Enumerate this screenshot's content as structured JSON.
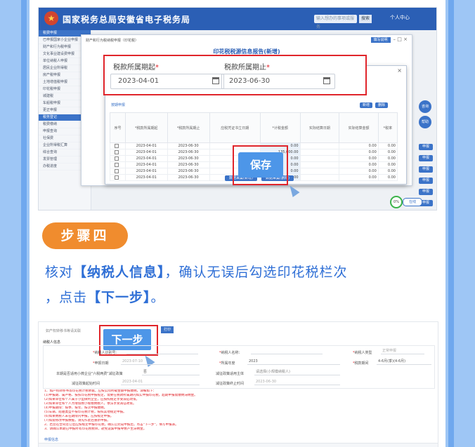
{
  "screenshot_top": {
    "app_title": "国家税务总局安徽省电子税务局",
    "search_placeholder": "输入想办的事项或服务",
    "search_button": "搜索",
    "user": "个人中心",
    "sidebar_items": [
      "税费申报",
      "已申报国家小企业申报",
      "财产和行为税申报",
      "文化事业建设费申报",
      "单位纳税人申报",
      "居民企业所得税",
      "房产税申报",
      "土地增值税申报",
      "印花税申报",
      "城建税",
      "车船税申报",
      "更正申报",
      "税务登记",
      "税费缴纳",
      "申报查询",
      "社保费",
      "企业所得税汇算",
      "综合查询",
      "发票管理",
      "办税进度"
    ],
    "outer_dialog_title": "财产和行为税纳税申报（印花税）",
    "outer_tag": "填写说明",
    "outer_form_title": "印花税税源信息报告(新增)",
    "period_start_label": "税款所属期起",
    "period_start_value": "2023-04-01",
    "period_end_label": "税款所属期止",
    "period_end_value": "2023-06-30",
    "required_mark": "*",
    "inner_section_label": "按期申报",
    "inner_pill_1": "新增",
    "inner_pill_2": "删除",
    "grid_headers": [
      "序号",
      "*税款所属期起",
      "*税款所属期止",
      "应税凭证书立日期",
      "*计税金额",
      "实际结算日期",
      "实际结算金额",
      "*税率"
    ],
    "grid_rows": [
      {
        "start": "2023-04-01",
        "end": "2023-06-30",
        "amount": "0.00",
        "settle": "0.00",
        "rate": "0.00"
      },
      {
        "start": "2023-04-01",
        "end": "2023-06-30",
        "amount": "135,000.00",
        "settle": "0.00",
        "rate": "0.00"
      },
      {
        "start": "2023-04-01",
        "end": "2023-06-30",
        "amount": "0.00",
        "settle": "0.00",
        "rate": "0.00"
      },
      {
        "start": "2023-04-01",
        "end": "2023-06-30",
        "amount": "0.00",
        "settle": "0.00",
        "rate": "0.00"
      },
      {
        "start": "2023-04-01",
        "end": "2023-06-30",
        "amount": "0.00",
        "settle": "0.00",
        "rate": "0.00"
      },
      {
        "start": "2023-04-01",
        "end": "2023-06-30",
        "amount": "0.00",
        "settle": "0.00",
        "rate": "0.00"
      }
    ],
    "bottom_btn_1": "数据采集(新增)",
    "bottom_btn_2": "数据采集(删除)",
    "save_label": "保存",
    "right_buttons": [
      "申报",
      "申报",
      "申报",
      "申报",
      "申报",
      "申报"
    ],
    "circle_buttons": [
      "咨询",
      "帮助"
    ],
    "status_circle": "0%",
    "status_pill": "在线"
  },
  "step": {
    "badge": "步骤四",
    "desc_line1_pre": "核对",
    "desc_line1_bold": "【纳税人信息】",
    "desc_line1_post": "，确认无误后勾选印花税栏次",
    "desc_line2_pre": "，点击",
    "desc_line2_bold": "【下一步】",
    "desc_line2_post": "。"
  },
  "screenshot_bottom": {
    "hint": "如产权转移书等请关联",
    "small_button": "打印",
    "next_label": "下一步",
    "section_title": "纳税人信息",
    "fields": {
      "taxpayer_id_label": "纳税人识别号：",
      "taxpayer_name_label": "纳税人名称：",
      "taxpayer_type_label": "纳税人类型",
      "taxpayer_type_value": "正常申报",
      "apply_date_label": "申报日期",
      "apply_date_value": "2023-07-10",
      "year_label": "所属年度",
      "year_value": "2023",
      "period_label": "税款期间",
      "period_value": "4-6月(季)(4-6月)",
      "small_biz_label": "本期是否适用小微企业\"六税两费\"减征政策",
      "small_biz_value": "否",
      "reduce_subject_label": "减征政策适用主体",
      "reduce_subject_value": "请选择(小规模纳税人)",
      "reduce_start_label": "减征政策起始时间",
      "reduce_start_value": "2023-04-01",
      "reduce_end_label": "减征政策终止时间",
      "reduce_end_value": "2023-06-30"
    },
    "notes": [
      "1、如产权转移书等印花税计税依据，应按实际所载金额申报缴纳，详细如下：",
      "(1)申报期、属严格、按照印花税申报规定，需要在税款所属期内如实申报印花税，超期申报需缴纳滞纳金。",
      "(2)如果单位和个人属于小型微利企业，应按照规定享受减征政策。",
      "(3)如果单位和个人为增值税小规模纳税人，依法享受减征政策。",
      "(4)申报期限：按季、按年、按次申报缴纳。",
      "(5)车辆、船舶类型不按印花税计税，按照其他规定申报。",
      "(6)如果纳税人未在期限内申报，应按规定申报。",
      "(7)如需修改申报数据，请先作废后重新申报。",
      "2、若您在合同签订后应按规定申报印花税，确认已完成申报后，点击\"下一步\"，填写申报表。",
      "3、请确认本期已申报所有印花税税目，避免遗漏申报导致产生滞纳金。"
    ],
    "footer_label": "申报信息"
  }
}
